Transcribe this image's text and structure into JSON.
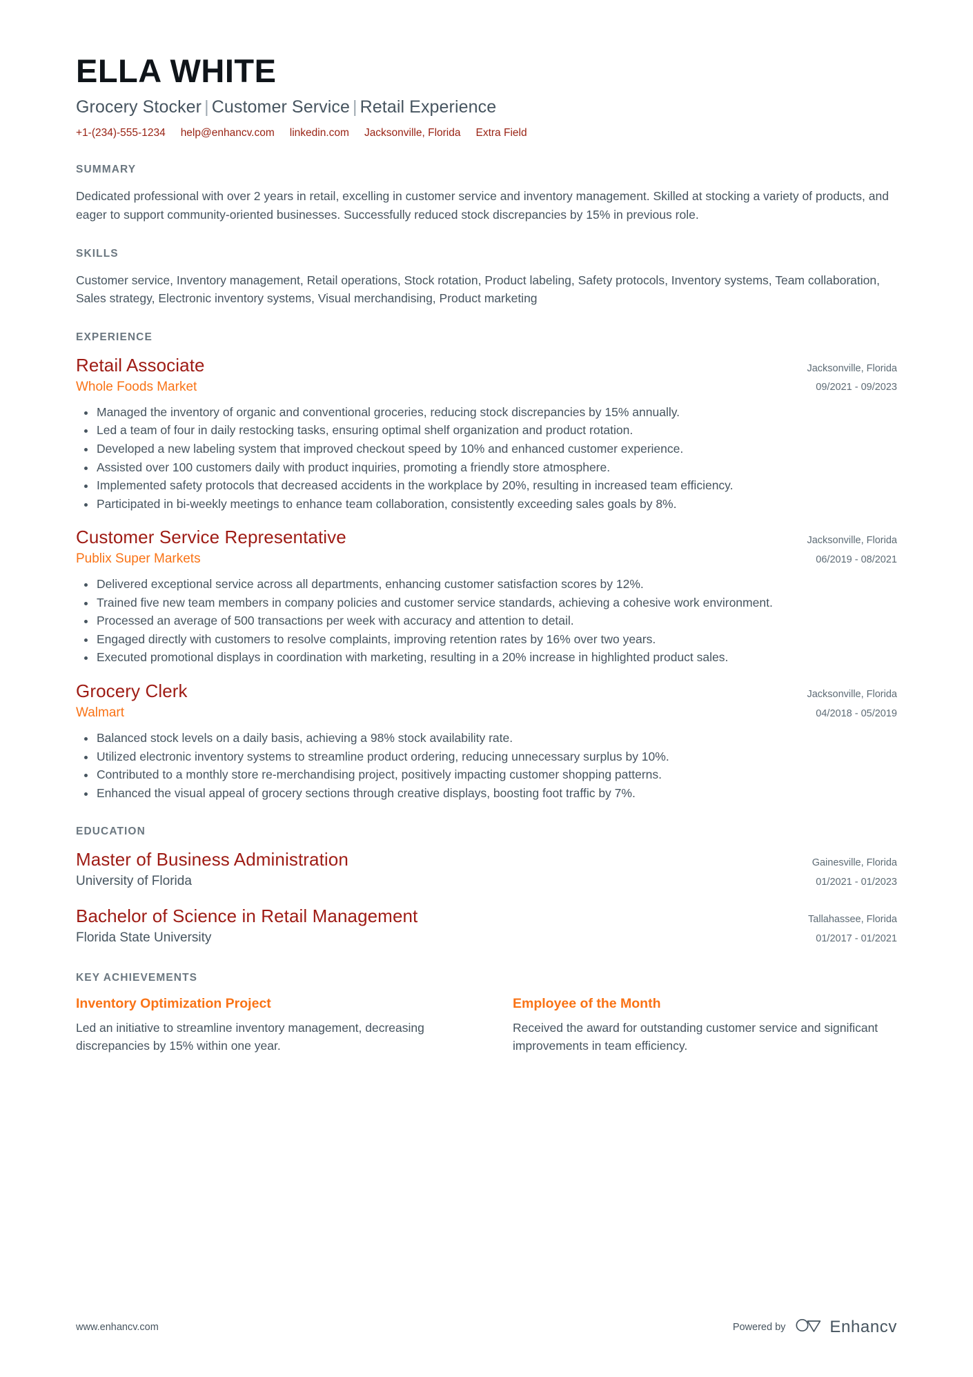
{
  "header": {
    "name": "ELLA WHITE",
    "headline_parts": [
      "Grocery Stocker",
      "Customer Service",
      "Retail Experience"
    ],
    "headline_separator": "|",
    "contacts": [
      {
        "name": "phone",
        "text": "+1-(234)-555-1234"
      },
      {
        "name": "email",
        "text": "help@enhancv.com"
      },
      {
        "name": "linkedin",
        "text": "linkedin.com"
      },
      {
        "name": "location",
        "text": "Jacksonville, Florida"
      },
      {
        "name": "extra-field",
        "text": "Extra Field"
      }
    ],
    "accent_color": "#992314"
  },
  "summary": {
    "title": "SUMMARY",
    "text": "Dedicated professional with over 2 years in retail, excelling in customer service and inventory management. Skilled at stocking a variety of products, and eager to support community-oriented businesses. Successfully reduced stock discrepancies by 15% in previous role."
  },
  "skills": {
    "title": "SKILLS",
    "text": "Customer service, Inventory management, Retail operations, Stock rotation, Product labeling, Safety protocols, Inventory systems, Team collaboration, Sales strategy, Electronic inventory systems, Visual merchandising, Product marketing"
  },
  "experience": {
    "title": "EXPERIENCE",
    "entries": [
      {
        "job_title": "Retail Associate",
        "company": "Whole Foods Market",
        "location": "Jacksonville, Florida",
        "dates": "09/2021 - 09/2023",
        "bullets": [
          "Managed the inventory of organic and conventional groceries, reducing stock discrepancies by 15% annually.",
          "Led a team of four in daily restocking tasks, ensuring optimal shelf organization and product rotation.",
          "Developed a new labeling system that improved checkout speed by 10% and enhanced customer experience.",
          "Assisted over 100 customers daily with product inquiries, promoting a friendly store atmosphere.",
          "Implemented safety protocols that decreased accidents in the workplace by 20%, resulting in increased team efficiency.",
          "Participated in bi-weekly meetings to enhance team collaboration, consistently exceeding sales goals by 8%."
        ]
      },
      {
        "job_title": "Customer Service Representative",
        "company": "Publix Super Markets",
        "location": "Jacksonville, Florida",
        "dates": "06/2019 - 08/2021",
        "bullets": [
          "Delivered exceptional service across all departments, enhancing customer satisfaction scores by 12%.",
          "Trained five new team members in company policies and customer service standards, achieving a cohesive work environment.",
          "Processed an average of 500 transactions per week with accuracy and attention to detail.",
          "Engaged directly with customers to resolve complaints, improving retention rates by 16% over two years.",
          "Executed promotional displays in coordination with marketing, resulting in a 20% increase in highlighted product sales."
        ]
      },
      {
        "job_title": "Grocery Clerk",
        "company": "Walmart",
        "location": "Jacksonville, Florida",
        "dates": "04/2018 - 05/2019",
        "bullets": [
          "Balanced stock levels on a daily basis, achieving a 98% stock availability rate.",
          "Utilized electronic inventory systems to streamline product ordering, reducing unnecessary surplus by 10%.",
          "Contributed to a monthly store re-merchandising project, positively impacting customer shopping patterns.",
          "Enhanced the visual appeal of grocery sections through creative displays, boosting foot traffic by 7%."
        ]
      }
    ]
  },
  "education": {
    "title": "EDUCATION",
    "entries": [
      {
        "degree": "Master of Business Administration",
        "school": "University of Florida",
        "location": "Gainesville, Florida",
        "dates": "01/2021 - 01/2023"
      },
      {
        "degree": "Bachelor of Science in Retail Management",
        "school": "Florida State University",
        "location": "Tallahassee, Florida",
        "dates": "01/2017 - 01/2021"
      }
    ]
  },
  "key_achievements": {
    "title": "KEY ACHIEVEMENTS",
    "items": [
      {
        "title": "Inventory Optimization Project",
        "description": "Led an initiative to streamline inventory management, decreasing discrepancies by 15% within one year."
      },
      {
        "title": "Employee of the Month",
        "description": "Received the award for outstanding customer service and significant improvements in team efficiency."
      }
    ]
  },
  "footer": {
    "url": "www.enhancv.com",
    "powered_by_label": "Powered by",
    "brand_name": "Enhancv"
  }
}
